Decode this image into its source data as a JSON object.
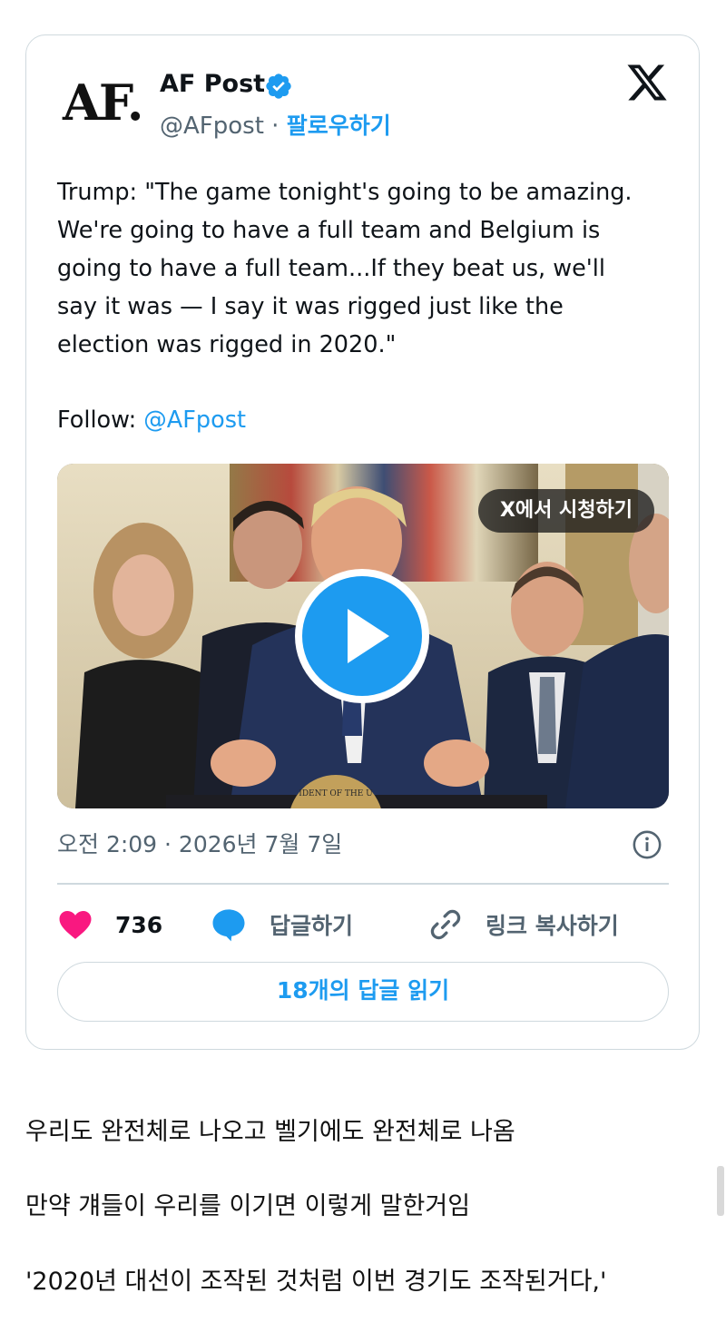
{
  "tweet": {
    "author_logo_text": "AF.",
    "author_name": "AF Post",
    "handle": "@AFpost",
    "separator": "·",
    "follow_label": "팔로우하기",
    "text": "Trump: \"The game tonight's going to be amazing.\nWe're going to have a full team and Belgium is\ngoing to have a full team...If they beat us, we'll\nsay it was — I say it was rigged just like the\nelection was rigged in 2020.\"",
    "follow_prefix": "Follow: ",
    "follow_mention": "@AFpost",
    "media": {
      "watch_label": "X에서 시청하기",
      "podium_seal_text": "IDENT OF THE U"
    },
    "timestamp": "오전 2:09 · 2026년 7월 7일",
    "actions": {
      "like_count": "736",
      "reply_label": "답글하기",
      "copy_link_label": "링크 복사하기"
    },
    "read_replies_label": "18개의 답글 읽기"
  },
  "body_text": {
    "line1": "우리도 완전체로 나오고 벨기에도 완전체로 나옴",
    "line2": "만약 걔들이 우리를 이기면 이렇게 말한거임",
    "line3": "'2020년 대선이 조작된 것처럼 이번 경기도 조작된거다,'"
  },
  "colors": {
    "accent_blue": "#1d9bf0",
    "like_pink": "#f91880",
    "border": "#cfd9de",
    "muted_text": "#536471"
  },
  "icons": [
    "verified-badge-icon",
    "x-logo-icon",
    "play-icon",
    "info-icon",
    "heart-icon",
    "reply-bubble-icon",
    "link-icon"
  ]
}
